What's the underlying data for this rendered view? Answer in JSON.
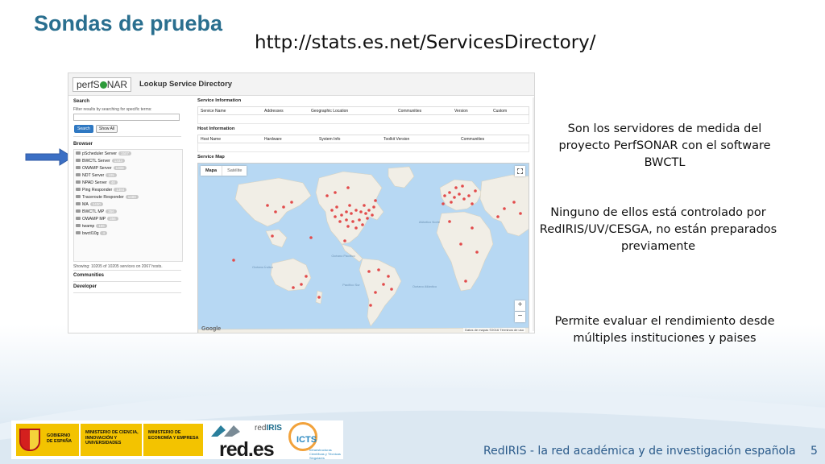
{
  "slide": {
    "title": "Sondas de prueba",
    "url": "http://stats.es.net/ServicesDirectory/",
    "notes": [
      "Son los servidores de medida del proyecto PerfSONAR con el software BWCTL",
      "Ninguno de ellos está controlado por RedIRIS/UV/CESGA, no están preparados previamente",
      "Permite evaluar el rendimiento desde múltiples instituciones y paises"
    ],
    "footer": "RedIRIS - la red académica y de investigación española",
    "page_number": "5"
  },
  "app": {
    "logo_text": "perfS",
    "logo_text_end": "NAR",
    "title": "Lookup Service Directory",
    "search": {
      "label": "Search",
      "hint": "Filter results by searching for specific terms:",
      "input_value": "",
      "search_button": "Search",
      "show_all_button": "Show All"
    },
    "browser": {
      "label": "Browser",
      "items": [
        {
          "label": "pScheduler Server",
          "count": "1507"
        },
        {
          "label": "BWCTL Server",
          "count": "1333"
        },
        {
          "label": "OWAMP Server",
          "count": "1308"
        },
        {
          "label": "NDT Server",
          "count": "105"
        },
        {
          "label": "NPAD Server",
          "count": "48"
        },
        {
          "label": "Ping Responder",
          "count": "1384"
        },
        {
          "label": "Traceroute Responder",
          "count": "1488"
        },
        {
          "label": "MA",
          "count": "1430"
        },
        {
          "label": "BWCTL MP",
          "count": "356"
        },
        {
          "label": "OWAMP MP",
          "count": "356"
        },
        {
          "label": "twamp",
          "count": "186"
        },
        {
          "label": "bwctl10g",
          "count": "4"
        }
      ],
      "status": "Showing: 10205 of 10205 services on 2067 hosts."
    },
    "communities_label": "Communities",
    "developer_label": "Developer",
    "service_information": {
      "label": "Service Information",
      "columns": [
        "Service Name",
        "Addresses",
        "Geographic Location",
        "Communities",
        "Version",
        "Custom"
      ]
    },
    "host_information": {
      "label": "Host Information",
      "columns": [
        "Host Name",
        "Hardware",
        "System Info",
        "Toolkit Version",
        "Communities"
      ]
    },
    "service_map": {
      "label": "Service Map",
      "tab_map": "Mapa",
      "tab_satellite": "Satélite",
      "zoom_in": "+",
      "zoom_out": "−",
      "google": "Google",
      "copyright": "Datos de mapas ©2016  Términos de uso",
      "oceans": {
        "north_pacific": "Océano Pacífico",
        "north_atlantic": "Atlántico Norte",
        "south_pacific": "Pacífico Sur",
        "south_atlantic": "Océano Atlántico",
        "indian": "Océano Índico"
      }
    }
  },
  "logos": {
    "gobierno": "GOBIERNO DE ESPAÑA",
    "ministerio_ciencia": "MINISTERIO DE CIENCIA, INNOVACIÓN Y UNIVERSIDADES",
    "ministerio_economia": "MINISTERIO DE ECONOMÍA Y EMPRESA",
    "redes": "red.es",
    "rediris_red": "red",
    "rediris_iris": "IRIS",
    "icts": "ICTS",
    "icts_caption": "Infraestructuras Científicas y Técnicas Singulares"
  },
  "colors": {
    "title": "#2a6f8f",
    "marker": "#e24b4b",
    "arrow": "#3b6fc4",
    "land": "#f1eee6",
    "water": "#b7d8f3"
  }
}
